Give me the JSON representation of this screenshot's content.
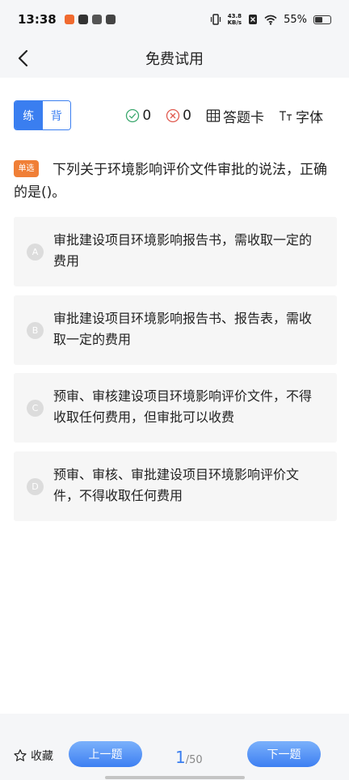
{
  "status_bar": {
    "time": "13:38",
    "net_speed_value": "43.8",
    "net_speed_unit": "KB/s",
    "battery": "55%",
    "battery_level": 0.55
  },
  "header": {
    "title": "免费试用",
    "back_icon": "chevron-left-icon"
  },
  "toolbar": {
    "mode_practice": "练",
    "mode_recite": "背",
    "active_mode": "practice",
    "correct_count": "0",
    "wrong_count": "0",
    "answer_card_label": "答题卡",
    "font_label": "字体",
    "accent_color": "#3a7ef0"
  },
  "question": {
    "type_tag": "单选",
    "type_tag_color": "#f07f37",
    "text": "下列关于环境影响评价文件审批的说法，正确的是()。"
  },
  "options": [
    {
      "letter": "A",
      "text": "审批建设项目环境影响报告书，需收取一定的费用"
    },
    {
      "letter": "B",
      "text": "审批建设项目环境影响报告书、报告表，需收取一定的费用"
    },
    {
      "letter": "C",
      "text": "预审、审核建设项目环境影响评价文件，不得收取任何费用，但审批可以收费"
    },
    {
      "letter": "D",
      "text": "预审、审核、审批建设项目环境影响评价文件，不得收取任何费用"
    }
  ],
  "bottom_bar": {
    "favorite_label": "收藏",
    "prev_label": "上一题",
    "next_label": "下一题",
    "current_page": "1",
    "page_separator": "/",
    "total_pages": "50"
  }
}
